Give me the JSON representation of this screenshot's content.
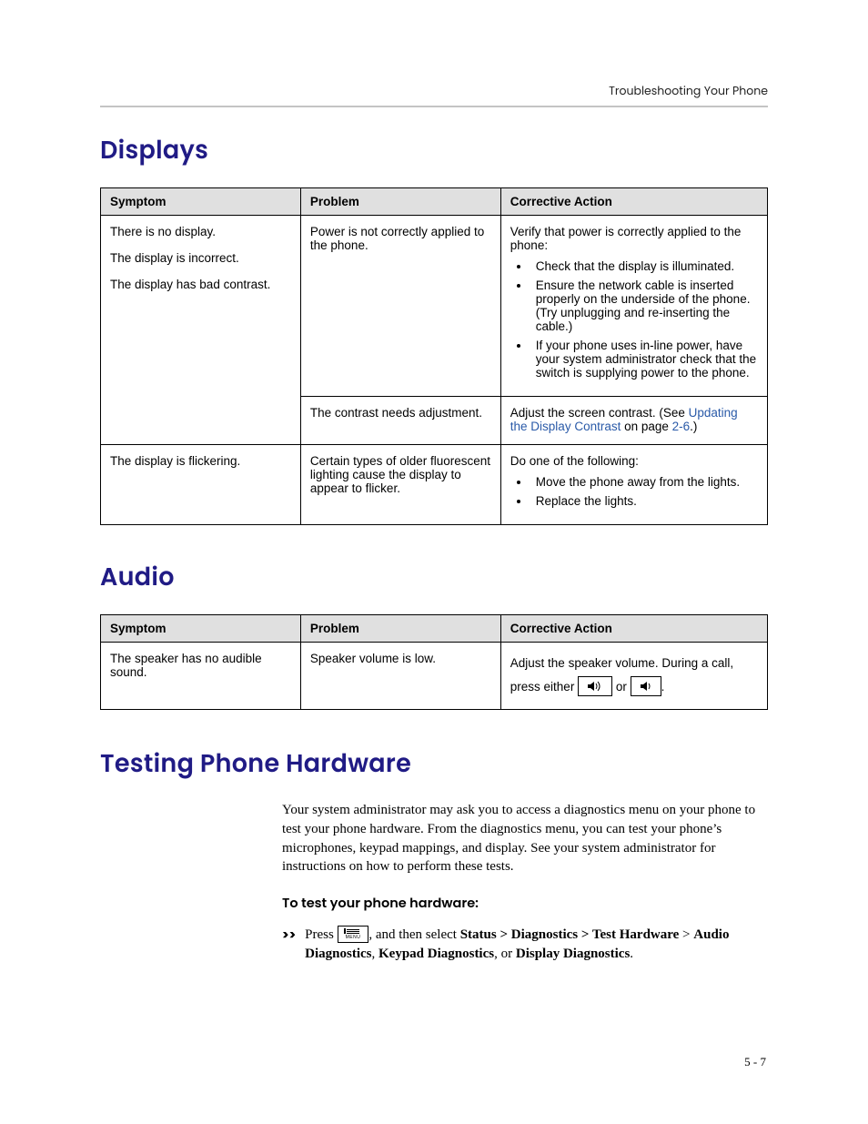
{
  "running_header": "Troubleshooting Your Phone",
  "page_number": "5 - 7",
  "sections": {
    "displays": {
      "heading": "Displays",
      "table": {
        "headers": [
          "Symptom",
          "Problem",
          "Corrective Action"
        ],
        "rows": [
          {
            "symptom_lines": [
              "There is no display.",
              "The display is incorrect.",
              "The display has bad contrast."
            ],
            "problem": "Power is not correctly applied to the phone.",
            "action_lead": "Verify that power is correctly applied to the phone:",
            "action_bullets": [
              "Check that the display is illuminated.",
              "Ensure the network cable is inserted properly on the underside of the phone. (Try unplugging and re-inserting the cable.)",
              "If your phone uses in-line power, have your system administrator check that the switch is supplying power to the phone."
            ]
          },
          {
            "symptom_lines": [],
            "problem": "The contrast needs adjustment.",
            "action_pre": "Adjust the screen contrast. (See ",
            "action_link": "Updating the Display Contrast",
            "action_post_1": " on page ",
            "action_page_link": "2-6",
            "action_post_2": ".)"
          },
          {
            "symptom_lines": [
              "The display is flickering."
            ],
            "problem": "Certain types of older fluorescent lighting cause the display to appear to flicker.",
            "action_lead": "Do one of the following:",
            "action_bullets": [
              "Move the phone away from the lights.",
              "Replace the lights."
            ]
          }
        ]
      }
    },
    "audio": {
      "heading": "Audio",
      "table": {
        "headers": [
          "Symptom",
          "Problem",
          "Corrective Action"
        ],
        "rows": [
          {
            "symptom": "The speaker has no audible sound.",
            "problem": "Speaker volume is low.",
            "action_pre": "Adjust the speaker volume. During a call, press either ",
            "or_text": " or ",
            "tail": "."
          }
        ]
      }
    },
    "testing": {
      "heading": "Testing Phone Hardware",
      "body": "Your system administrator may ask you to access a diagnostics menu on your phone to test your phone hardware. From the diagnostics menu, you can test your phone’s microphones, keypad mappings, and display. See your system administrator for instructions on how to perform these tests.",
      "sub_heading": "To test your phone hardware:",
      "step_marker": ">>",
      "step": {
        "pre": "Press ",
        "post_1": ", and then select ",
        "bold_1": "Status > Diagnostics > Test Hardware",
        "post_2": " > ",
        "bold_2": "Audio Diagnostics",
        "sep_1": ", ",
        "bold_3": "Keypad Diagnostics",
        "sep_2": ", or ",
        "bold_4": "Display Diagnostics",
        "tail": "."
      }
    }
  }
}
